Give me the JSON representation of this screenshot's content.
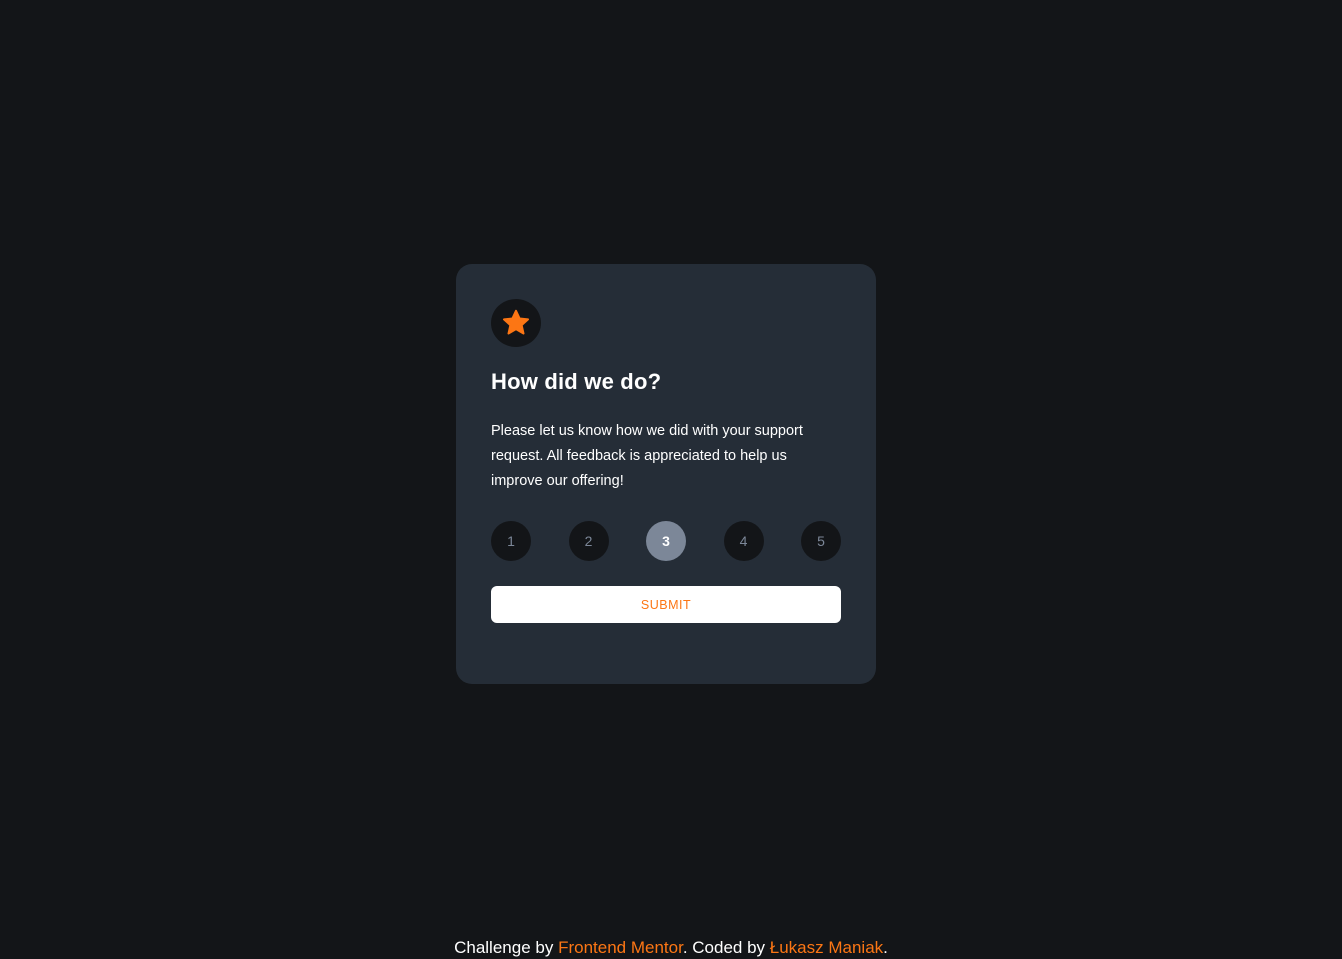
{
  "colors": {
    "background": "#131518",
    "card": "#252d37",
    "accent": "#fc7614",
    "muted": "#7c8798",
    "text": "#ffffff"
  },
  "card": {
    "icon": "star-icon",
    "title": "How did we do?",
    "description": "Please let us know how we did with your support request. All feedback is appreciated to help us improve our offering!",
    "ratings": [
      {
        "label": "1",
        "selected": false
      },
      {
        "label": "2",
        "selected": false
      },
      {
        "label": "3",
        "selected": true
      },
      {
        "label": "4",
        "selected": false
      },
      {
        "label": "5",
        "selected": false
      }
    ],
    "submit_label": "SUBMIT"
  },
  "footer": {
    "prefix": "Challenge by ",
    "link1": "Frontend Mentor",
    "middle": ". Coded by ",
    "link2": "Łukasz Maniak",
    "suffix": "."
  }
}
